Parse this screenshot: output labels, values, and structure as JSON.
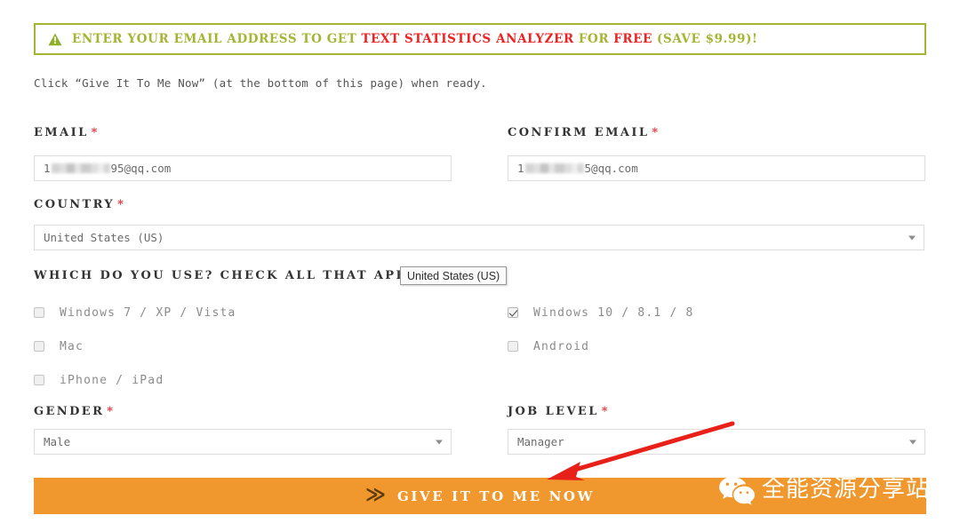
{
  "notice": {
    "icon": "warning-triangle-icon",
    "parts": [
      {
        "text": "ENTER YOUR EMAIL ADDRESS TO GET",
        "highlight": false
      },
      {
        "text": "TEXT STATISTICS ANALYZER",
        "highlight": true
      },
      {
        "text": "FOR",
        "highlight": false
      },
      {
        "text": "FREE",
        "highlight": true
      },
      {
        "text": "(SAVE $9.99)!",
        "highlight": false
      }
    ],
    "border_color": "#a5b532",
    "text_color": "#a5b532",
    "highlight_color": "#ee2222"
  },
  "instruction": "Click “Give It To Me Now” (at the bottom of this page) when ready.",
  "form": {
    "required_mark": "*",
    "email": {
      "label": "EMAIL",
      "value_prefix": "1",
      "value_suffix": "95@qq.com",
      "redacted": true
    },
    "confirm_email": {
      "label": "CONFIRM EMAIL",
      "value_prefix": "1",
      "value_suffix": "5@qq.com",
      "redacted": true
    },
    "country": {
      "label": "COUNTRY",
      "value": "United States (US)"
    },
    "country_popup": {
      "value": "United States (US)"
    },
    "which_use": {
      "label": "WHICH DO YOU USE? CHECK ALL THAT APPLY",
      "options_left": [
        {
          "label": "Windows 7 / XP / Vista",
          "checked": false
        },
        {
          "label": "Mac",
          "checked": false
        },
        {
          "label": "iPhone / iPad",
          "checked": false
        }
      ],
      "options_right": [
        {
          "label": "Windows 10 / 8.1 / 8",
          "checked": true
        },
        {
          "label": "Android",
          "checked": false
        }
      ]
    },
    "gender": {
      "label": "GENDER",
      "value": "Male"
    },
    "job_level": {
      "label": "JOB LEVEL",
      "value": "Manager"
    }
  },
  "submit": {
    "icon": "double-chevron-right-icon",
    "glyph": "≫",
    "label": "GIVE IT TO ME NOW",
    "color": "#f0982d"
  },
  "annotation": {
    "type": "arrow",
    "color": "#e8201a"
  },
  "watermark": {
    "icon": "wechat-icon",
    "text": "全能资源分享站",
    "color": "#ffffff"
  }
}
